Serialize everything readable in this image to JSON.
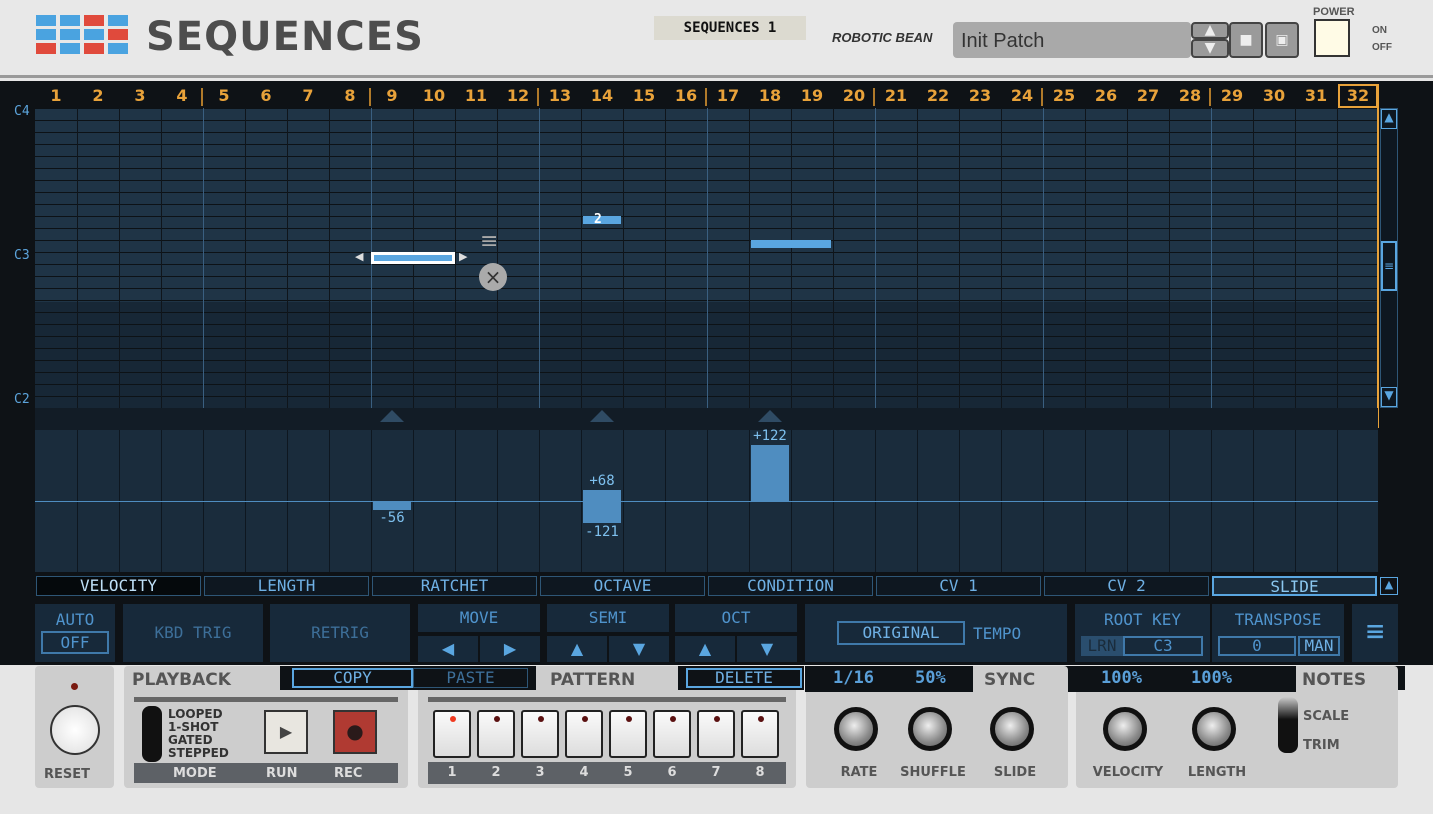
{
  "header": {
    "title": "SEQUENCES",
    "instance_name": "SEQUENCES 1",
    "brand": "ROBOTIC BEAN",
    "patch_name": "Init Patch",
    "power_label": "POWER",
    "power_on": "ON",
    "power_off": "OFF"
  },
  "colors": {
    "accent": "#5aa6e0",
    "step_numbers": "#e8a23a",
    "logo_blue": "#4aa3e0",
    "logo_red": "#e04a3c"
  },
  "steps": [
    "1",
    "2",
    "3",
    "4",
    "5",
    "6",
    "7",
    "8",
    "9",
    "10",
    "11",
    "12",
    "13",
    "14",
    "15",
    "16",
    "17",
    "18",
    "19",
    "20",
    "21",
    "22",
    "23",
    "24",
    "25",
    "26",
    "27",
    "28",
    "29",
    "30",
    "31",
    "32"
  ],
  "selected_step": "32",
  "octave_labels": [
    "C4",
    "C3",
    "C2"
  ],
  "notes": [
    {
      "step": 9,
      "length": 2,
      "pitch": "C3",
      "selected": true
    },
    {
      "step": 14,
      "length": 1,
      "pitch": "D#3",
      "ratchet": "2"
    },
    {
      "step": 18,
      "length": 2,
      "pitch": "C#3"
    }
  ],
  "lane_values": [
    {
      "step": 9,
      "value": "-56"
    },
    {
      "step": 14,
      "value": "+68",
      "value2": "-121"
    },
    {
      "step": 18,
      "value": "+122"
    }
  ],
  "lane_tabs": [
    "VELOCITY",
    "LENGTH",
    "RATCHET",
    "OCTAVE",
    "CONDITION",
    "CV 1",
    "CV 2",
    "SLIDE"
  ],
  "selected_lane_tab": "SLIDE",
  "controls": {
    "auto": "AUTO",
    "auto_value": "OFF",
    "kbd_trig": "KBD TRIG",
    "retrig": "RETRIG",
    "move": "MOVE",
    "semi": "SEMI",
    "oct": "OCT",
    "original": "ORIGINAL",
    "tempo": "TEMPO",
    "root_key": "ROOT KEY",
    "lrn": "LRN",
    "root_value": "C3",
    "transpose": "TRANSPOSE",
    "transpose_value": "0",
    "man": "MAN"
  },
  "playback": {
    "title": "PLAYBACK",
    "copy": "COPY",
    "paste": "PASTE",
    "modes": [
      "LOOPED",
      "1-SHOT",
      "GATED",
      "STEPPED"
    ],
    "mode": "MODE",
    "run": "RUN",
    "rec": "REC",
    "reset": "RESET"
  },
  "pattern": {
    "title": "PATTERN",
    "delete": "DELETE",
    "buttons": [
      "1",
      "2",
      "3",
      "4",
      "5",
      "6",
      "7",
      "8"
    ],
    "active": "1"
  },
  "sync": {
    "title": "SYNC",
    "rate_value": "1/16",
    "shuffle_value": "50%",
    "knobs": [
      "RATE",
      "SHUFFLE",
      "SLIDE"
    ]
  },
  "notes_panel": {
    "title": "NOTES",
    "velocity_value": "100%",
    "length_value": "100%",
    "knobs": [
      "VELOCITY",
      "LENGTH"
    ],
    "switch": [
      "SCALE",
      "TRIM"
    ]
  }
}
